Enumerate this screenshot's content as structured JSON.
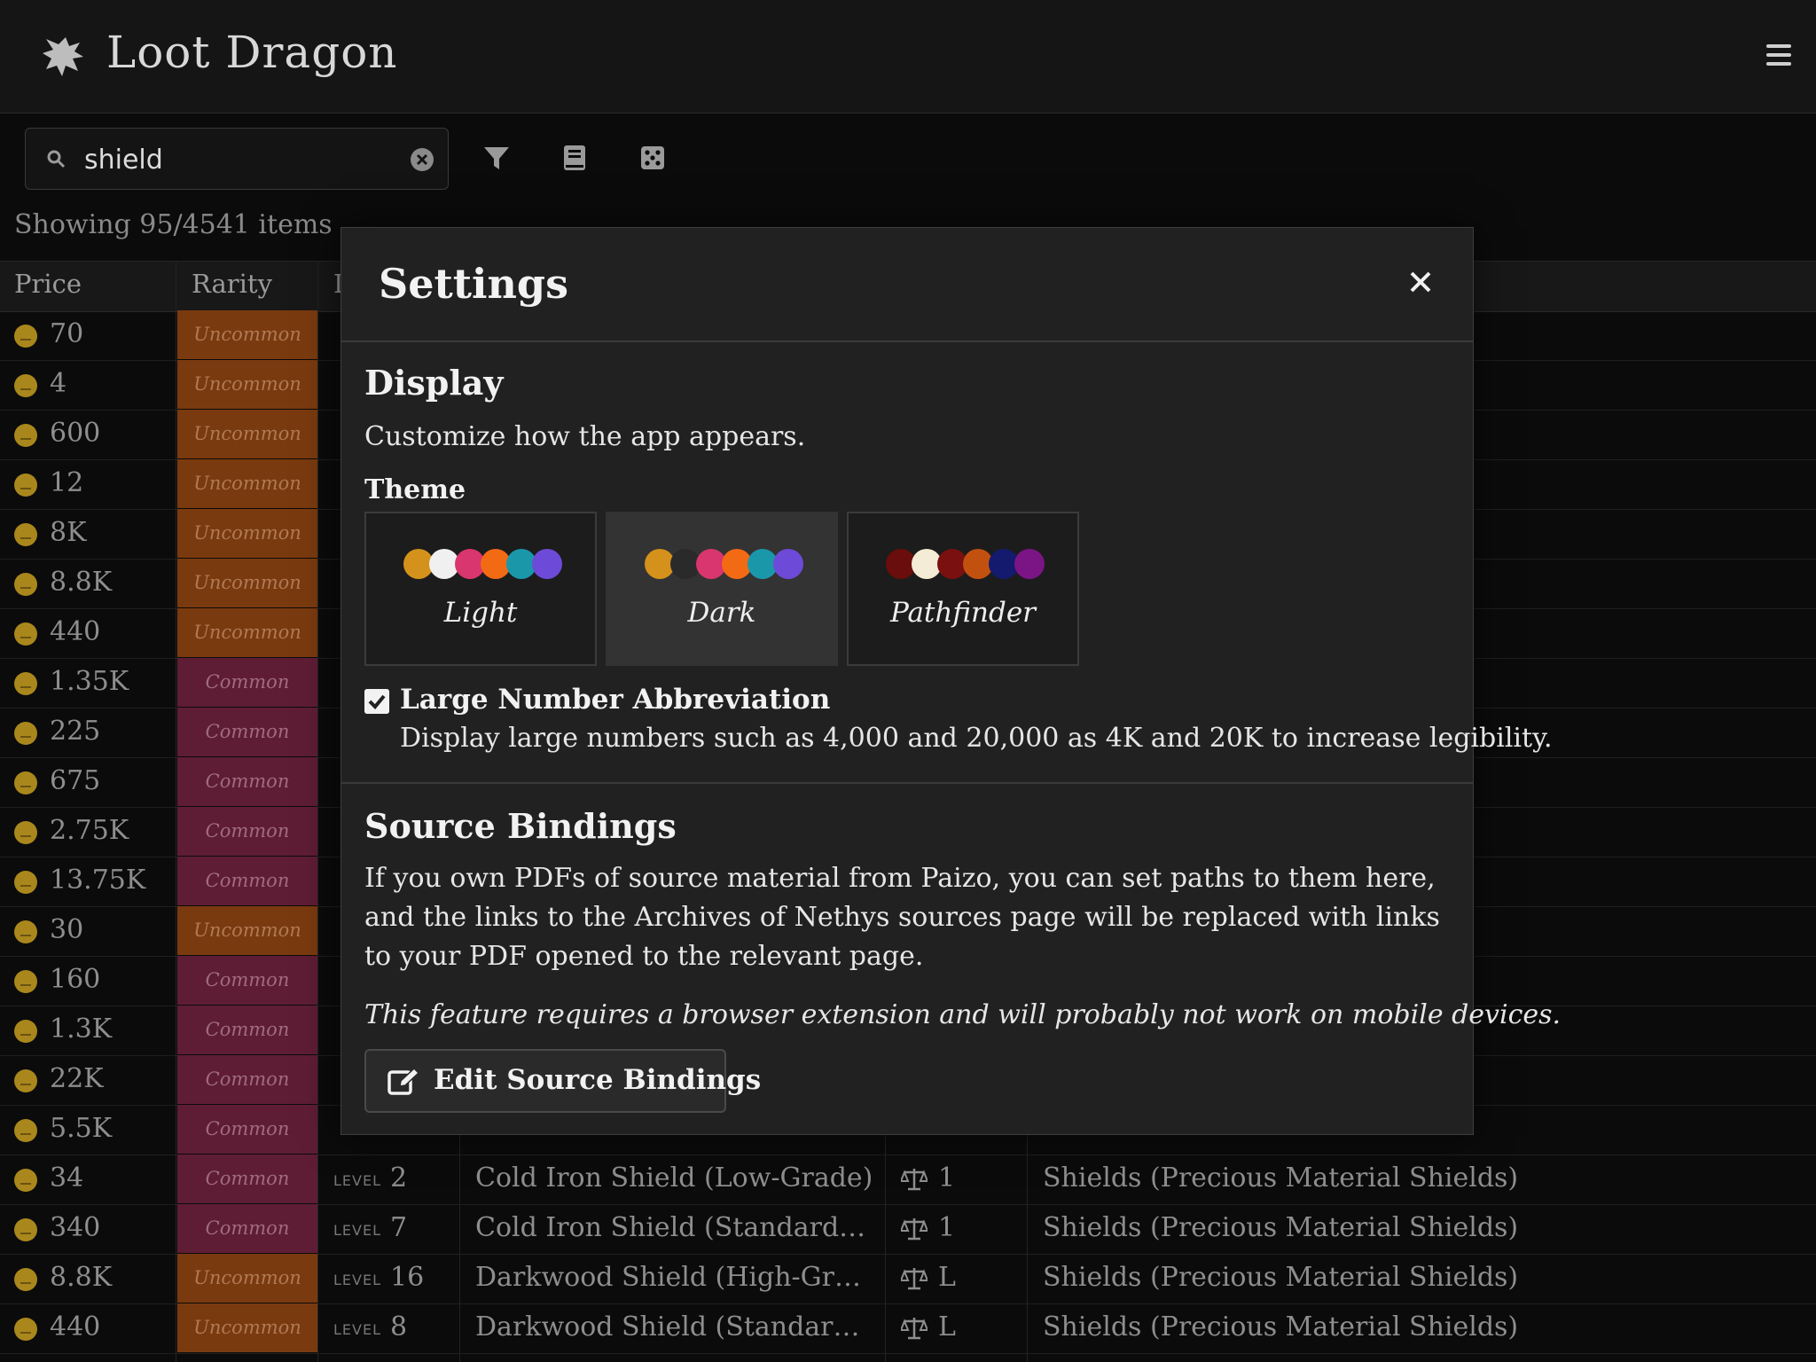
{
  "app": {
    "title": "Loot Dragon"
  },
  "search": {
    "value": "shield",
    "placeholder": ""
  },
  "results": {
    "count_text": "Showing 95/4541 items"
  },
  "table": {
    "headers": [
      "Price",
      "Rarity",
      "L"
    ],
    "level_label": "LEVEL",
    "rows": [
      {
        "price": "70",
        "rarity": "Uncommon"
      },
      {
        "price": "4",
        "rarity": "Uncommon"
      },
      {
        "price": "600",
        "rarity": "Uncommon"
      },
      {
        "price": "12",
        "rarity": "Uncommon"
      },
      {
        "price": "8K",
        "rarity": "Uncommon"
      },
      {
        "price": "8.8K",
        "rarity": "Uncommon"
      },
      {
        "price": "440",
        "rarity": "Uncommon"
      },
      {
        "price": "1.35K",
        "rarity": "Common"
      },
      {
        "price": "225",
        "rarity": "Common"
      },
      {
        "price": "675",
        "rarity": "Common"
      },
      {
        "price": "2.75K",
        "rarity": "Common"
      },
      {
        "price": "13.75K",
        "rarity": "Common"
      },
      {
        "price": "30",
        "rarity": "Uncommon"
      },
      {
        "price": "160",
        "rarity": "Common"
      },
      {
        "price": "1.3K",
        "rarity": "Common"
      },
      {
        "price": "22K",
        "rarity": "Common"
      },
      {
        "price": "5.5K",
        "rarity": "Common"
      },
      {
        "price": "34",
        "rarity": "Common",
        "level": "2",
        "name": "Cold Iron Shield (Low-Grade)",
        "bulk": "1",
        "category": "Shields (Precious Material Shields)"
      },
      {
        "price": "340",
        "rarity": "Common",
        "level": "7",
        "name": "Cold Iron Shield (Standard-Gra...",
        "bulk": "1",
        "category": "Shields (Precious Material Shields)"
      },
      {
        "price": "8.8K",
        "rarity": "Uncommon",
        "level": "16",
        "name": "Darkwood Shield (High-Grade)",
        "bulk": "L",
        "category": "Shields (Precious Material Shields)"
      },
      {
        "price": "440",
        "rarity": "Uncommon",
        "level": "8",
        "name": "Darkwood Shield (Standard-Gr...",
        "bulk": "L",
        "category": "Shields (Precious Material Shields)"
      }
    ]
  },
  "settings": {
    "title": "Settings",
    "display": {
      "title": "Display",
      "description": "Customize how the app appears.",
      "theme_label": "Theme",
      "themes": [
        {
          "name": "Light",
          "selected": false,
          "colors": [
            "#d4921c",
            "#f0f0f0",
            "#d9356f",
            "#f36a14",
            "#1b97aa",
            "#6d4ad8"
          ]
        },
        {
          "name": "Dark",
          "selected": true,
          "colors": [
            "#d4921c",
            "#2a2a2a",
            "#d9356f",
            "#f36a14",
            "#1b97aa",
            "#6d4ad8"
          ]
        },
        {
          "name": "Pathfinder",
          "selected": false,
          "colors": [
            "#6a0d0d",
            "#f4ecd6",
            "#7a1010",
            "#c2510f",
            "#141a6e",
            "#7b1586"
          ]
        }
      ],
      "large_number": {
        "checked": true,
        "title": "Large Number Abbreviation",
        "description": "Display large numbers such as 4,000 and 20,000 as 4K and 20K to increase legibility."
      }
    },
    "source_bindings": {
      "title": "Source Bindings",
      "description": "If you own PDFs of source material from Paizo, you can set paths to them here, and the links to the Archives of Nethys sources page will be replaced with links to your PDF opened to the relevant page.",
      "note": "This feature requires a browser extension and will probably not work on mobile devices.",
      "button_label": "Edit Source Bindings"
    }
  }
}
